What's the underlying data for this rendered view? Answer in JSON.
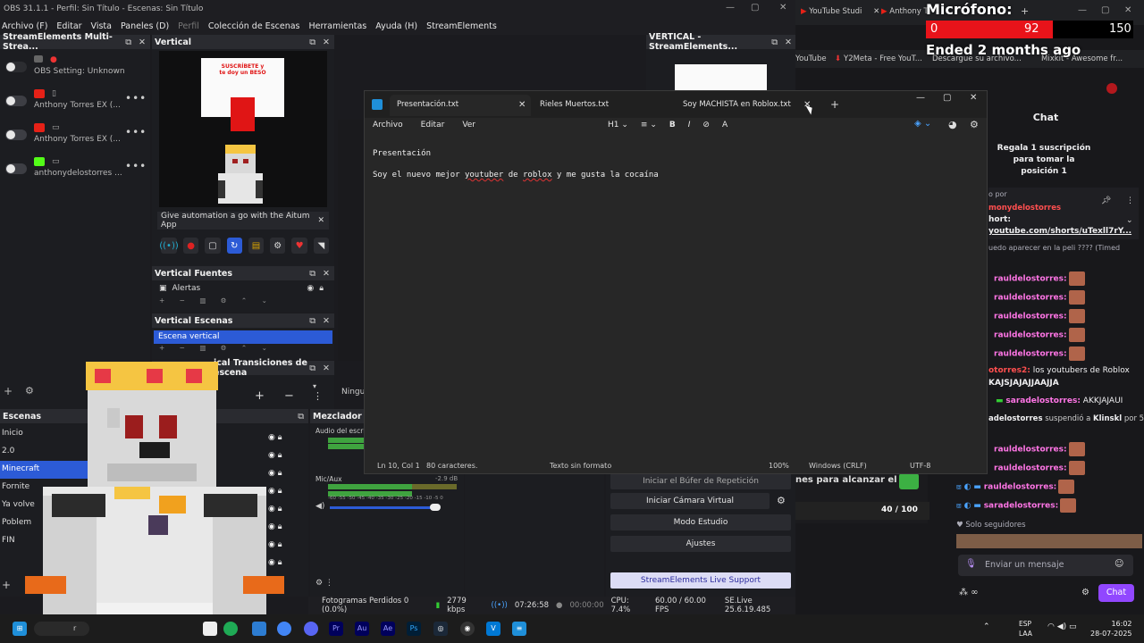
{
  "obs": {
    "title": "OBS 31.1.1 - Perfil: Sin Título - Escenas: Sin Título",
    "menu": [
      "Archivo (F)",
      "Editar",
      "Vista",
      "Paneles (D)",
      "Perfil",
      "Colección de Escenas",
      "Herramientas",
      "Ayuda (H)",
      "StreamElements"
    ],
    "multistream": {
      "title": "StreamElements Multi-Strea...",
      "setting": "OBS Setting: Unknown",
      "rows": [
        "Anthony Torres EX (...",
        "Anthony Torres EX (...",
        "anthonydelostorres ..."
      ]
    },
    "vertical": {
      "title": "Vertical",
      "automation": "Give automation a go with the Aitum App",
      "preview_line1": "SUSCRÍBETE y",
      "preview_line2": "te doy un BESO"
    },
    "fuentes": {
      "title": "Vertical Fuentes",
      "item": "Alertas"
    },
    "escenas": {
      "title": "Vertical Escenas",
      "item": "Escena vertical"
    },
    "transiciones": {
      "title": "Vertical Transiciones de escena",
      "title_visible": "ical Transiciones de escena",
      "label": "Ningu"
    },
    "scenes": {
      "title": "Escenas",
      "items": [
        "Inicio",
        "2.0",
        "Minecraft",
        "Fornite",
        "Ya volve",
        "Poblem",
        "FIN"
      ]
    },
    "mixer": {
      "title": "Mezclador de",
      "ch1": "Audio del escri",
      "ch2": "Mic/Aux",
      "db": "-2.9 dB",
      "scale": "-60 -55 -50 -45 -40 -35 -30 -25 -20 -15 -10 -5 0"
    },
    "controls": {
      "buffer": "Iniciar el Búfer de Repetición",
      "camera": "Iniciar Cámara Virtual",
      "studio": "Modo Estudio",
      "settings": "Ajustes",
      "support": "StreamElements Live Support"
    },
    "vertical_se": "VERTICAL - StreamElements...",
    "stats": {
      "dropped": "Fotogramas Perdidos 0 (0.0%)",
      "kbps": "2779 kbps",
      "time": "07:26:58",
      "rec": "00:00:00",
      "cpu": "CPU: 7.4%",
      "fps": "60.00 / 60.00 FPS",
      "version": "SE.Live 25.6.19.485"
    }
  },
  "notepad": {
    "tabs": [
      "Presentación.txt",
      "Rieles Muertos.txt",
      "Soy MACHISTA en Roblox.txt"
    ],
    "menu": [
      "Archivo",
      "Editar",
      "Ver"
    ],
    "format": [
      "H1",
      "≡",
      "B",
      "I",
      "⊘",
      "A"
    ],
    "line1": "Presentación",
    "line2_a": "Soy el nuevo mejor ",
    "line2_b": "youtuber",
    "line2_c": " de ",
    "line2_d": "roblox",
    "line2_e": " y me gusta la cocaína",
    "status": {
      "pos": "Ln 10, Col 1",
      "chars": "80 caracteres.",
      "format": "Texto sin formato",
      "zoom": "100%",
      "eol": "Windows (CRLF)",
      "enc": "UTF-8"
    }
  },
  "browser": {
    "tabs": [
      "YouTube Studi",
      "Anthony T"
    ],
    "bookmarks": [
      "YouTube",
      "Y2Meta - Free YouT...",
      "Descargue su archivo...",
      "Mixkit - Awesome fr..."
    ]
  },
  "overlay": {
    "mic_label": "Micrófono:",
    "min": "0",
    "current": "92",
    "max": "150",
    "level_fraction": 0.613,
    "ended": "Ended 2 months ago"
  },
  "chat": {
    "header": "Chat",
    "sub_line1": "Regala 1 suscripción para tomar la",
    "sub_line2": "posición 1",
    "pinned_by": "o por",
    "pinned_user": "monydelostorres",
    "pinned_label": "hort:",
    "pinned_link": "youtube.com/shorts/uTexll7rY...",
    "question": "uedo aparecer en la peli ???? (Timed",
    "user1": "rauldelostorres:",
    "msg_user": "otorres2:",
    "msg_text1": " los youtubers de Roblox",
    "msg_text2": "KAJSJAJAJJAAJJA",
    "user2": "saradelostorres:",
    "msg2": " AKKJAJAUI",
    "mod_user": "adelostorres",
    "mod_text": " suspendió a ",
    "mod_target": "Klinskl",
    "mod_tail": " por 5",
    "goal": "40 / 100",
    "goal_text": "nes para alcanzar el",
    "followers": "Solo seguidores",
    "input_placeholder": "Enviar un mensaje",
    "send": "Chat"
  },
  "taskbar": {
    "lang1": "ESP",
    "lang2": "LAA",
    "time": "16:02",
    "date": "28-07-2025",
    "search": "r"
  },
  "colors": {
    "accent": "#2c5bd6",
    "twitch": "#9147ff",
    "mic_red": "#e8131a"
  }
}
